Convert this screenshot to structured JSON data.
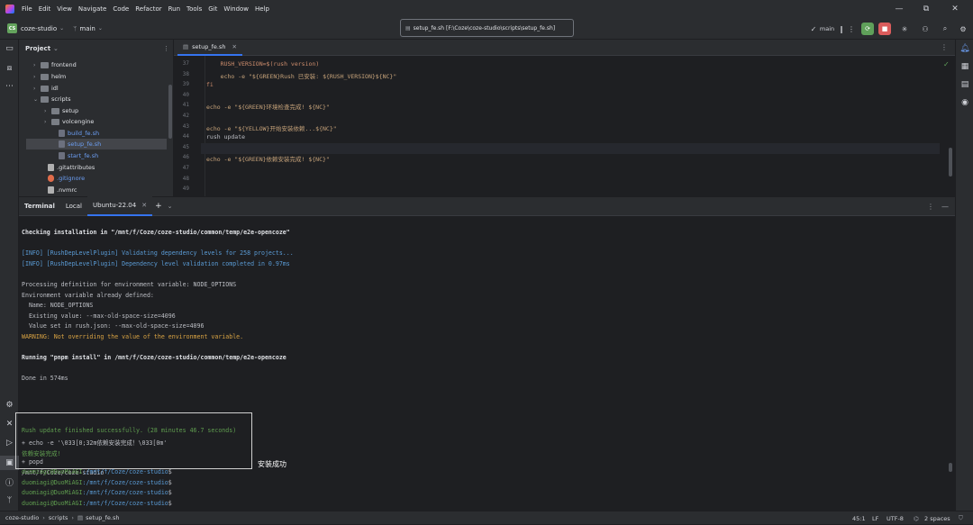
{
  "menu": [
    "File",
    "Edit",
    "View",
    "Navigate",
    "Code",
    "Refactor",
    "Run",
    "Tools",
    "Git",
    "Window",
    "Help"
  ],
  "toolbar": {
    "project_badge": "CS",
    "project_name": "coze-studio",
    "branch": "main",
    "file_path": "setup_fe.sh [F:\\Coze\\coze-studio\\scripts\\setup_fe.sh]",
    "run_branch": "main"
  },
  "project_panel": {
    "title": "Project",
    "items": [
      {
        "label": "frontend",
        "type": "folder"
      },
      {
        "label": "helm",
        "type": "folder"
      },
      {
        "label": "idl",
        "type": "folder"
      },
      {
        "label": "scripts",
        "type": "folder-open"
      },
      {
        "label": "setup",
        "type": "folder"
      },
      {
        "label": "volcengine",
        "type": "folder"
      },
      {
        "label": "build_fe.sh",
        "type": "file"
      },
      {
        "label": "setup_fe.sh",
        "type": "file-selected"
      },
      {
        "label": "start_fe.sh",
        "type": "file"
      },
      {
        "label": ".gitattributes",
        "type": "file"
      },
      {
        "label": ".gitignore",
        "type": "file"
      },
      {
        "label": ".nvmrc",
        "type": "file"
      }
    ]
  },
  "editor": {
    "tab": "setup_fe.sh",
    "lines": [
      {
        "n": "37",
        "text": "    RUSH_VERSION=$(rush version)"
      },
      {
        "n": "38",
        "text": "    echo -e \"${GREEN}Rush 已安装: ${RUSH_VERSION}${NC}\""
      },
      {
        "n": "39",
        "text": "fi"
      },
      {
        "n": "40",
        "text": ""
      },
      {
        "n": "41",
        "text": "echo -e \"${GREEN}环境检查完成! ${NC}\""
      },
      {
        "n": "42",
        "text": ""
      },
      {
        "n": "43",
        "text": "echo -e \"${YELLOW}开始安装依赖...${NC}\""
      },
      {
        "n": "44",
        "text": "rush update"
      },
      {
        "n": "45",
        "text": ""
      },
      {
        "n": "46",
        "text": "echo -e \"${GREEN}依赖安装完成! ${NC}\""
      },
      {
        "n": "47",
        "text": ""
      },
      {
        "n": "48",
        "text": ""
      },
      {
        "n": "49",
        "text": ""
      }
    ]
  },
  "terminal": {
    "title": "Terminal",
    "tabs": [
      "Local",
      "Ubuntu-22.04"
    ],
    "lines": [
      {
        "text": "Checking installation in \"/mnt/f/Coze/coze-studio/common/temp/e2e-opencoze\"",
        "style": "bold"
      },
      {
        "text": "",
        "style": ""
      },
      {
        "text": "[INFO] [RushDepLevelPlugin] Validating dependency levels for 258 projects...",
        "style": "info"
      },
      {
        "text": "[INFO] [RushDepLevelPlugin] Dependency level validation completed in 0.97ms",
        "style": "info"
      },
      {
        "text": "",
        "style": ""
      },
      {
        "text": "Processing definition for environment variable: NODE_OPTIONS",
        "style": ""
      },
      {
        "text": "Environment variable already defined:",
        "style": ""
      },
      {
        "text": "  Name: NODE_OPTIONS",
        "style": ""
      },
      {
        "text": "  Existing value: --max-old-space-size=4096",
        "style": ""
      },
      {
        "text": "  Value set in rush.json: --max-old-space-size=4096",
        "style": ""
      },
      {
        "text": "WARNING: Not overriding the value of the environment variable.",
        "style": "warn"
      },
      {
        "text": "",
        "style": ""
      },
      {
        "text": "Running \"pnpm install\" in /mnt/f/Coze/coze-studio/common/temp/e2e-opencoze",
        "style": "bold"
      },
      {
        "text": "",
        "style": ""
      },
      {
        "text": "Done in 574ms",
        "style": ""
      },
      {
        "text": "",
        "style": ""
      },
      {
        "text": "",
        "style": ""
      },
      {
        "text": "",
        "style": ""
      },
      {
        "text": "",
        "style": ""
      },
      {
        "text": "Rush update finished successfully. (28 minutes 46.7 seconds)",
        "style": "green"
      },
      {
        "text": "+ echo -e '\\033[0;32m依赖安装完成！\\033[0m'",
        "style": ""
      },
      {
        "text": "依赖安装完成!",
        "style": "green"
      },
      {
        "text": "+ popd",
        "style": ""
      },
      {
        "text": "/mnt/f/Coze/coze-studio",
        "style": ""
      }
    ],
    "prompts": [
      {
        "user": "duomiagi@DuoMiAGI",
        "path": ":/mnt/f/Coze/coze-studio",
        "sym": "$"
      },
      {
        "user": "duomiagi@DuoMiAGI",
        "path": ":/mnt/f/Coze/coze-studio",
        "sym": "$"
      },
      {
        "user": "duomiagi@DuoMiAGI",
        "path": ":/mnt/f/Coze/coze-studio",
        "sym": "$"
      },
      {
        "user": "duomiagi@DuoMiAGI",
        "path": ":/mnt/f/Coze/coze-studio",
        "sym": "$"
      }
    ],
    "annotation": "安装成功"
  },
  "statusbar": {
    "breadcrumb": [
      "coze-studio",
      "scripts",
      "setup_fe.sh"
    ],
    "position": "45:1",
    "line_ending": "LF",
    "encoding": "UTF-8",
    "indent": "2 spaces"
  }
}
